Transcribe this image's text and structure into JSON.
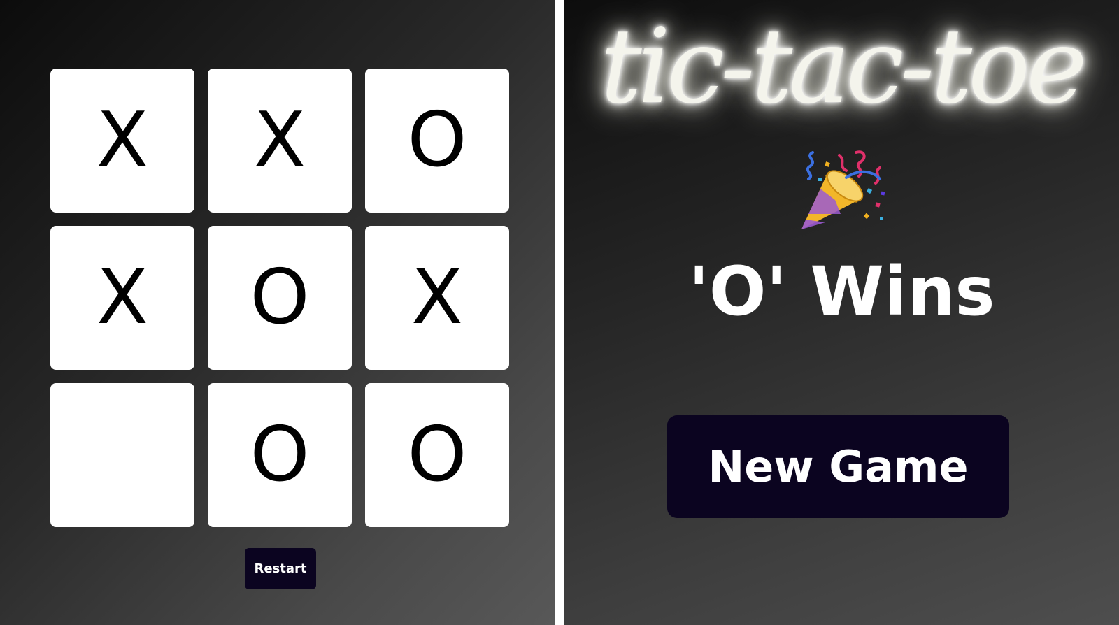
{
  "game": {
    "board": [
      "X",
      "X",
      "O",
      "X",
      "O",
      "X",
      "",
      "O",
      "O"
    ],
    "restart_label": "Restart"
  },
  "result": {
    "title": "tic-tac-toe",
    "message": "'O' Wins",
    "new_game_label": "New Game",
    "celebration_icon": "party-popper-icon"
  },
  "colors": {
    "button_bg": "#0b0420",
    "cell_bg": "#ffffff",
    "mark_color": "#000000",
    "title_glow": "#f4f4ec"
  }
}
